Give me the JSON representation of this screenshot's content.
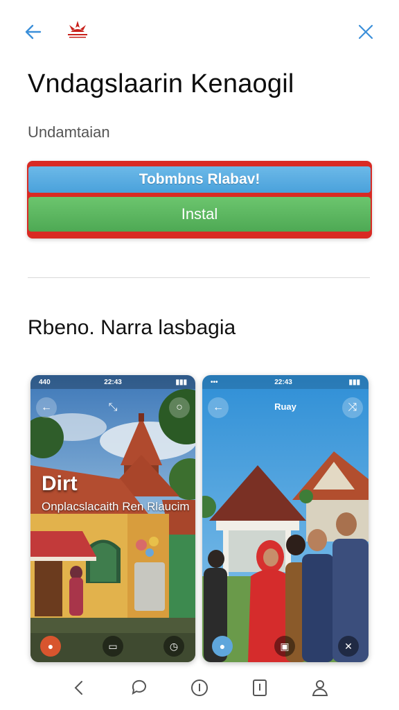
{
  "header": {
    "back_icon": "arrow-left-icon",
    "close_icon": "close-icon",
    "logo": "brand-logo",
    "accent": "#3b8fd9"
  },
  "app": {
    "title": "Vndagslaarin Kenaogil",
    "developer": "Undamtaian"
  },
  "actions": {
    "secondary_label": "Tobmbns Rlabav!",
    "install_label": "Instal",
    "secondary_color": "#4aa1db",
    "install_color": "#4ea954",
    "frame_color": "#d92a23"
  },
  "screenshots_section": {
    "title": "Rbeno. Narra lasbagia",
    "items": [
      {
        "status_time": "22:43",
        "status_left": "440",
        "top_left_icon": "arrow-left-icon",
        "top_center_icon": "link-icon",
        "top_right_icon": "search-icon",
        "overlay_title": "Dirt",
        "overlay_sub": "Onplacslacaith Ren Rlaucim",
        "bottom_icons": [
          "pin-icon",
          "calendar-icon",
          "clock-icon"
        ]
      },
      {
        "status_time": "22:43",
        "status_left": "•••",
        "top_left_icon": "arrow-left-icon",
        "top_title": "Ruay",
        "top_right_icon": "share-icon",
        "bottom_icons": [
          "pin-icon",
          "photo-icon",
          "close-icon"
        ]
      }
    ]
  },
  "bottom_nav": {
    "items": [
      "back-icon",
      "chat-icon",
      "info-icon",
      "book-icon",
      "profile-icon"
    ]
  }
}
